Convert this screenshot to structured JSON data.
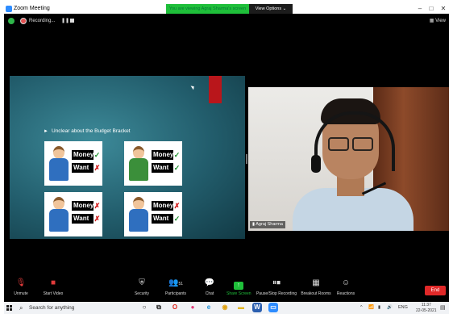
{
  "window": {
    "title": "Zoom Meeting",
    "minimize": "–",
    "maximize": "□",
    "close": "✕"
  },
  "share_banner": "You are viewing Agraj Sharma's screen",
  "view_options": "View Options ⌄",
  "status": {
    "recording_label": "Recording...",
    "pause": "❚❚",
    "view_label": "▦ View"
  },
  "slide": {
    "bullet": "Unclear about the Budget Bracket",
    "cards": [
      {
        "money": "Money",
        "money_mark": "✓",
        "want": "Want",
        "want_mark": "✗"
      },
      {
        "money": "Money",
        "money_mark": "✓",
        "want": "Want",
        "want_mark": "✓"
      },
      {
        "money": "Money",
        "money_mark": "✗",
        "want": "Want",
        "want_mark": "✗"
      },
      {
        "money": "Money",
        "money_mark": "✗",
        "want": "Want",
        "want_mark": "✓"
      }
    ]
  },
  "video": {
    "name": "Agraj Sharma",
    "signal": "▮"
  },
  "toolbar": {
    "unmute": "Unmute",
    "start_video": "Start Video",
    "security": "Security",
    "participants": "Participants",
    "participants_count": "51",
    "chat": "Chat",
    "share_screen": "Share Screen",
    "pause_recording": "Pause/Stop Recording",
    "breakout_rooms": "Breakout Rooms",
    "reactions": "Reactions",
    "end": "End",
    "caret": "^"
  },
  "taskbar": {
    "search_placeholder": "Search for anything",
    "language": "ENG",
    "time": "11:37",
    "date": "22-05-2021",
    "tray_arrow": "^"
  },
  "colors": {
    "share_green": "#1fbf3a",
    "end_red": "#e02828",
    "slide_teal": "#225d6c",
    "slide_red_bar": "#b9161b"
  }
}
